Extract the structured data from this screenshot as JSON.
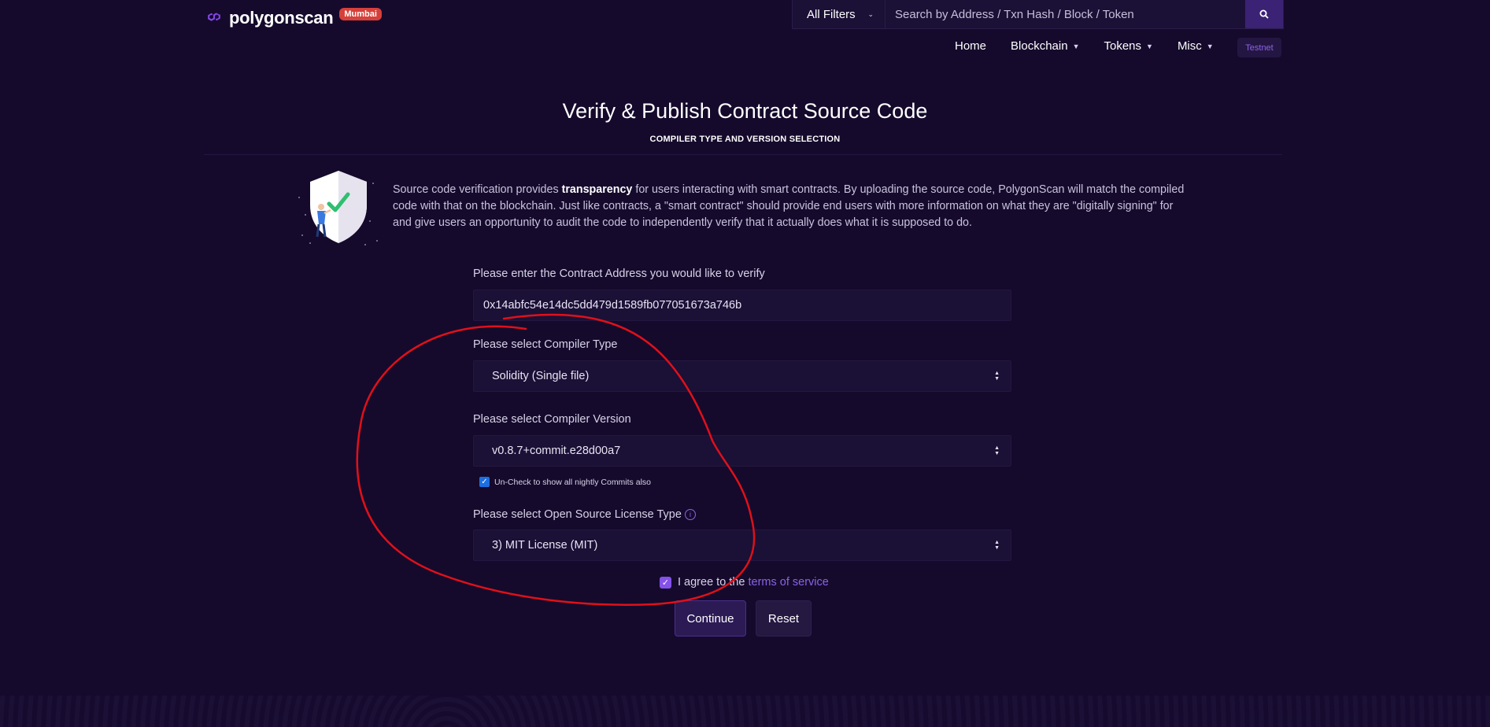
{
  "header": {
    "logo_text": "polygonscan",
    "network_badge": "Mumbai",
    "search": {
      "filter_label": "All Filters",
      "placeholder": "Search by Address / Txn Hash / Block / Token"
    },
    "nav": [
      {
        "label": "Home",
        "has_dropdown": false
      },
      {
        "label": "Blockchain",
        "has_dropdown": true
      },
      {
        "label": "Tokens",
        "has_dropdown": true
      },
      {
        "label": "Misc",
        "has_dropdown": true
      }
    ],
    "testnet_label": "Testnet"
  },
  "page": {
    "title": "Verify & Publish Contract Source Code",
    "subtitle": "COMPILER TYPE AND VERSION SELECTION"
  },
  "intro": {
    "before": "Source code verification provides ",
    "bold": "transparency",
    "after": " for users interacting with smart contracts. By uploading the source code, PolygonScan will match the compiled code with that on the blockchain. Just like contracts, a \"smart contract\" should provide end users with more information on what they are \"digitally signing\" for and give users an opportunity to audit the code to independently verify that it actually does what it is supposed to do."
  },
  "form": {
    "address_label": "Please enter the Contract Address you would like to verify",
    "address_value": "0x14abfc54e14dc5dd479d1589fb077051673a746b",
    "compiler_type_label": "Please select Compiler Type",
    "compiler_type_value": "Solidity (Single file)",
    "compiler_version_label": "Please select Compiler Version",
    "compiler_version_value": "v0.8.7+commit.e28d00a7",
    "nightly_label": "Un-Check to show all nightly Commits also",
    "nightly_checked": true,
    "license_label": "Please select Open Source License Type",
    "license_value": "3) MIT License (MIT)",
    "agree_prefix": "I agree to the ",
    "agree_link": "terms of service",
    "agree_checked": true,
    "continue_label": "Continue",
    "reset_label": "Reset"
  },
  "colors": {
    "background": "#150a2c",
    "accent": "#8a63e6",
    "badge": "#d6403a",
    "annotation": "#e0101a"
  }
}
